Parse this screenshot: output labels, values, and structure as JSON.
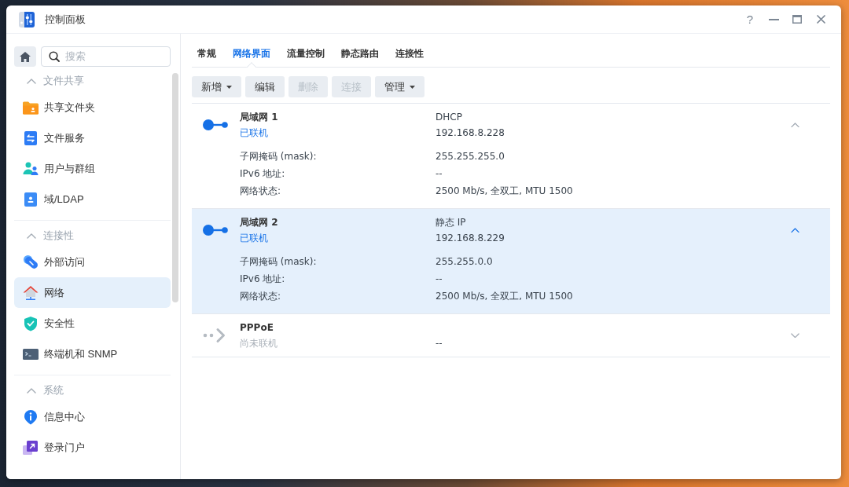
{
  "window": {
    "title": "控制面板",
    "help": "?"
  },
  "sidebar": {
    "search": {
      "placeholder": "搜索"
    },
    "sections": [
      {
        "title": "文件共享",
        "expanded": true,
        "items": [
          {
            "label": "共享文件夹",
            "selected": false
          },
          {
            "label": "文件服务",
            "selected": false
          },
          {
            "label": "用户与群组",
            "selected": false
          },
          {
            "label": "域/LDAP",
            "selected": false
          }
        ]
      },
      {
        "title": "连接性",
        "expanded": true,
        "items": [
          {
            "label": "外部访问",
            "selected": false
          },
          {
            "label": "网络",
            "selected": true
          },
          {
            "label": "安全性",
            "selected": false
          },
          {
            "label": "终端机和 SNMP",
            "selected": false
          }
        ]
      },
      {
        "title": "系统",
        "expanded": true,
        "items": [
          {
            "label": "信息中心",
            "selected": false
          },
          {
            "label": "登录门户",
            "selected": false
          }
        ]
      }
    ]
  },
  "tabs": [
    {
      "label": "常规",
      "selected": false
    },
    {
      "label": "网络界面",
      "selected": true
    },
    {
      "label": "流量控制",
      "selected": false
    },
    {
      "label": "静态路由",
      "selected": false
    },
    {
      "label": "连接性",
      "selected": false
    }
  ],
  "toolbar": [
    {
      "label": "新增",
      "dropdown": true,
      "disabled": false
    },
    {
      "label": "编辑",
      "dropdown": false,
      "disabled": false
    },
    {
      "label": "删除",
      "dropdown": false,
      "disabled": true
    },
    {
      "label": "连接",
      "dropdown": false,
      "disabled": true
    },
    {
      "label": "管理",
      "dropdown": true,
      "disabled": false
    }
  ],
  "interfaces": [
    {
      "name": "局域网 1",
      "status": "已联机",
      "connected": true,
      "mode": "DHCP",
      "ip": "192.168.8.228",
      "selected": false,
      "expanded": true,
      "details": [
        {
          "label": "子网掩码 (mask):",
          "value": "255.255.255.0"
        },
        {
          "label": "IPv6 地址:",
          "value": "--"
        },
        {
          "label": "网络状态:",
          "value": "2500 Mb/s, 全双工, MTU 1500"
        }
      ]
    },
    {
      "name": "局域网 2",
      "status": "已联机",
      "connected": true,
      "mode": "静态 IP",
      "ip": "192.168.8.229",
      "selected": true,
      "expanded": true,
      "details": [
        {
          "label": "子网掩码 (mask):",
          "value": "255.255.0.0"
        },
        {
          "label": "IPv6 地址:",
          "value": "--"
        },
        {
          "label": "网络状态:",
          "value": "2500 Mb/s, 全双工, MTU 1500"
        }
      ]
    },
    {
      "name": "PPPoE",
      "status": "尚未联机",
      "connected": false,
      "ip": "--",
      "selected": false,
      "expanded": false
    }
  ]
}
